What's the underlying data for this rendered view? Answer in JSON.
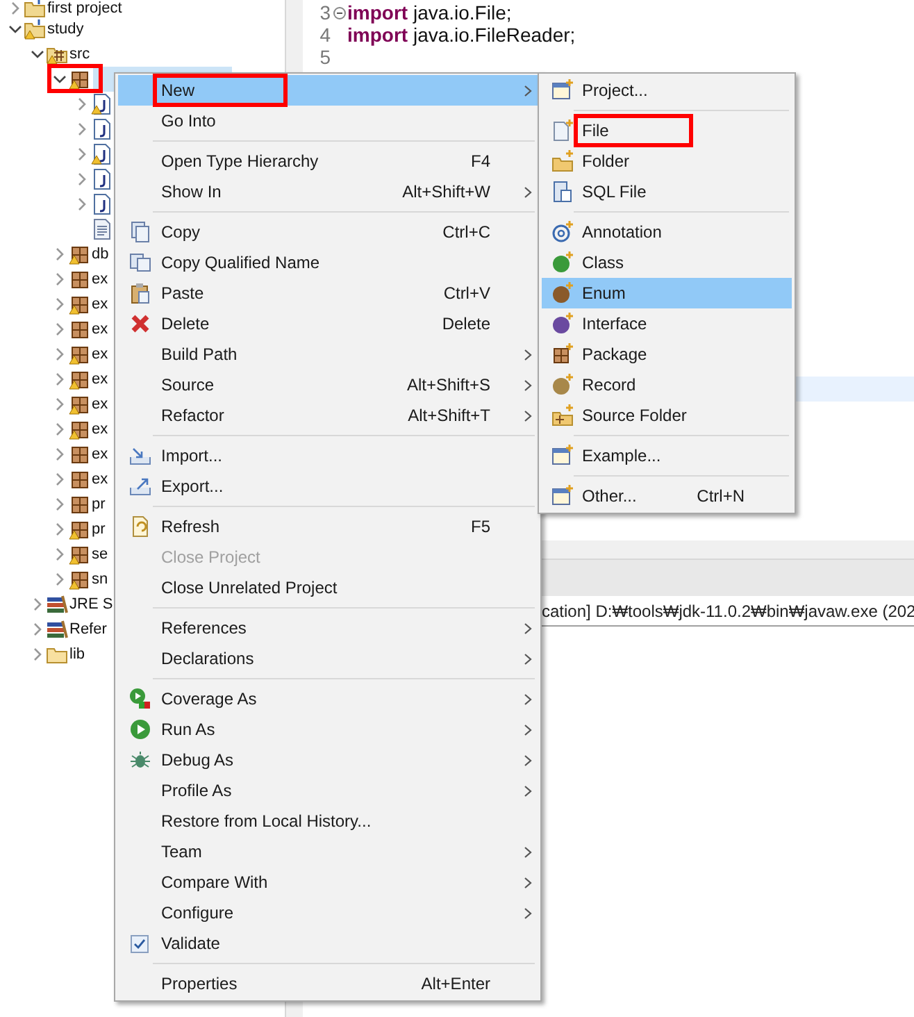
{
  "tree": [
    {
      "label": "first project",
      "kind": "project",
      "expanded": false,
      "warning": false
    },
    {
      "label": "study",
      "kind": "project",
      "expanded": true,
      "warning": true,
      "children": [
        {
          "label": "src",
          "kind": "source",
          "expanded": true,
          "warning": true,
          "children": [
            {
              "kind": "package",
              "expanded": true,
              "warning": true,
              "selected": true,
              "highlighted": true,
              "children": [
                {
                  "kind": "java",
                  "expanded": false,
                  "warning": true
                },
                {
                  "kind": "java",
                  "expanded": false,
                  "warning": false
                },
                {
                  "kind": "java",
                  "expanded": false,
                  "warning": true
                },
                {
                  "kind": "java",
                  "expanded": false,
                  "warning": false
                },
                {
                  "kind": "java",
                  "expanded": false,
                  "warning": false
                },
                {
                  "kind": "text",
                  "warning": false
                }
              ]
            },
            {
              "label": "db",
              "kind": "package",
              "expanded": false,
              "warning": true
            },
            {
              "label": "ex",
              "kind": "package",
              "expanded": false,
              "warning": false
            },
            {
              "label": "ex",
              "kind": "package",
              "expanded": false,
              "warning": true
            },
            {
              "label": "ex",
              "kind": "package",
              "expanded": false,
              "warning": false
            },
            {
              "label": "ex",
              "kind": "package",
              "expanded": false,
              "warning": true
            },
            {
              "label": "ex",
              "kind": "package",
              "expanded": false,
              "warning": true
            },
            {
              "label": "ex",
              "kind": "package",
              "expanded": false,
              "warning": true
            },
            {
              "label": "ex",
              "kind": "package",
              "expanded": false,
              "warning": true
            },
            {
              "label": "ex",
              "kind": "package",
              "expanded": false,
              "warning": false
            },
            {
              "label": "ex",
              "kind": "package",
              "expanded": false,
              "warning": false
            },
            {
              "label": "pr",
              "kind": "package",
              "expanded": false,
              "warning": false
            },
            {
              "label": "pr",
              "kind": "package",
              "expanded": false,
              "warning": true
            },
            {
              "label": "se",
              "kind": "package",
              "expanded": false,
              "warning": true
            },
            {
              "label": "sn",
              "kind": "package",
              "expanded": false,
              "warning": true
            }
          ]
        },
        {
          "label": "JRE S",
          "kind": "library",
          "expanded": false,
          "warning": false
        },
        {
          "label": "Refer",
          "kind": "library",
          "expanded": false,
          "warning": false
        },
        {
          "label": "lib",
          "kind": "folder",
          "expanded": false,
          "warning": false
        }
      ]
    }
  ],
  "editor": {
    "lines": [
      {
        "number": "3",
        "folded": true,
        "keyword": "import",
        "text": " java.io.File;"
      },
      {
        "number": "4",
        "folded": false,
        "keyword": "import",
        "text": " java.io.FileReader;"
      },
      {
        "number": "5",
        "folded": false
      }
    ]
  },
  "console": {
    "text": "cation] D:₩tools₩jdk-11.0.2₩bin₩javaw.exe  (202"
  },
  "context_menu": [
    {
      "kind": "item",
      "label": "New",
      "submenu": true,
      "selected": true,
      "highlighted": true
    },
    {
      "kind": "item",
      "label": "Go Into"
    },
    {
      "kind": "separator"
    },
    {
      "kind": "item",
      "label": "Open Type Hierarchy",
      "shortcut": "F4"
    },
    {
      "kind": "item",
      "label": "Show In",
      "shortcut": "Alt+Shift+W",
      "submenu": true
    },
    {
      "kind": "separator"
    },
    {
      "kind": "item",
      "label": "Copy",
      "shortcut": "Ctrl+C"
    },
    {
      "kind": "item",
      "label": "Copy Qualified Name"
    },
    {
      "kind": "item",
      "label": "Paste",
      "shortcut": "Ctrl+V"
    },
    {
      "kind": "item",
      "label": "Delete",
      "shortcut": "Delete"
    },
    {
      "kind": "item",
      "label": "Build Path",
      "submenu": true
    },
    {
      "kind": "item",
      "label": "Source",
      "shortcut": "Alt+Shift+S",
      "submenu": true
    },
    {
      "kind": "item",
      "label": "Refactor",
      "shortcut": "Alt+Shift+T",
      "submenu": true
    },
    {
      "kind": "separator"
    },
    {
      "kind": "item",
      "label": "Import..."
    },
    {
      "kind": "item",
      "label": "Export..."
    },
    {
      "kind": "separator"
    },
    {
      "kind": "item",
      "label": "Refresh",
      "shortcut": "F5"
    },
    {
      "kind": "item",
      "label": "Close Project",
      "disabled": true
    },
    {
      "kind": "item",
      "label": "Close Unrelated Project"
    },
    {
      "kind": "separator"
    },
    {
      "kind": "item",
      "label": "References",
      "submenu": true
    },
    {
      "kind": "item",
      "label": "Declarations",
      "submenu": true
    },
    {
      "kind": "separator"
    },
    {
      "kind": "item",
      "label": "Coverage As",
      "submenu": true
    },
    {
      "kind": "item",
      "label": "Run As",
      "submenu": true
    },
    {
      "kind": "item",
      "label": "Debug As",
      "submenu": true
    },
    {
      "kind": "item",
      "label": "Profile As",
      "submenu": true
    },
    {
      "kind": "item",
      "label": "Restore from Local History..."
    },
    {
      "kind": "item",
      "label": "Team",
      "submenu": true
    },
    {
      "kind": "item",
      "label": "Compare With",
      "submenu": true
    },
    {
      "kind": "item",
      "label": "Configure",
      "submenu": true
    },
    {
      "kind": "item",
      "label": "Validate",
      "checked": true
    },
    {
      "kind": "separator"
    },
    {
      "kind": "item",
      "label": "Properties",
      "shortcut": "Alt+Enter"
    }
  ],
  "submenu": [
    {
      "kind": "item",
      "label": "Project..."
    },
    {
      "kind": "separator"
    },
    {
      "kind": "item",
      "label": "File",
      "highlighted": true
    },
    {
      "kind": "item",
      "label": "Folder"
    },
    {
      "kind": "item",
      "label": "SQL File"
    },
    {
      "kind": "separator"
    },
    {
      "kind": "item",
      "label": "Annotation"
    },
    {
      "kind": "item",
      "label": "Class"
    },
    {
      "kind": "item",
      "label": "Enum",
      "selected": true
    },
    {
      "kind": "item",
      "label": "Interface"
    },
    {
      "kind": "item",
      "label": "Package"
    },
    {
      "kind": "item",
      "label": "Record"
    },
    {
      "kind": "item",
      "label": "Source Folder"
    },
    {
      "kind": "separator"
    },
    {
      "kind": "item",
      "label": "Example..."
    },
    {
      "kind": "separator"
    },
    {
      "kind": "item",
      "label": "Other...",
      "shortcut": "Ctrl+N"
    }
  ]
}
